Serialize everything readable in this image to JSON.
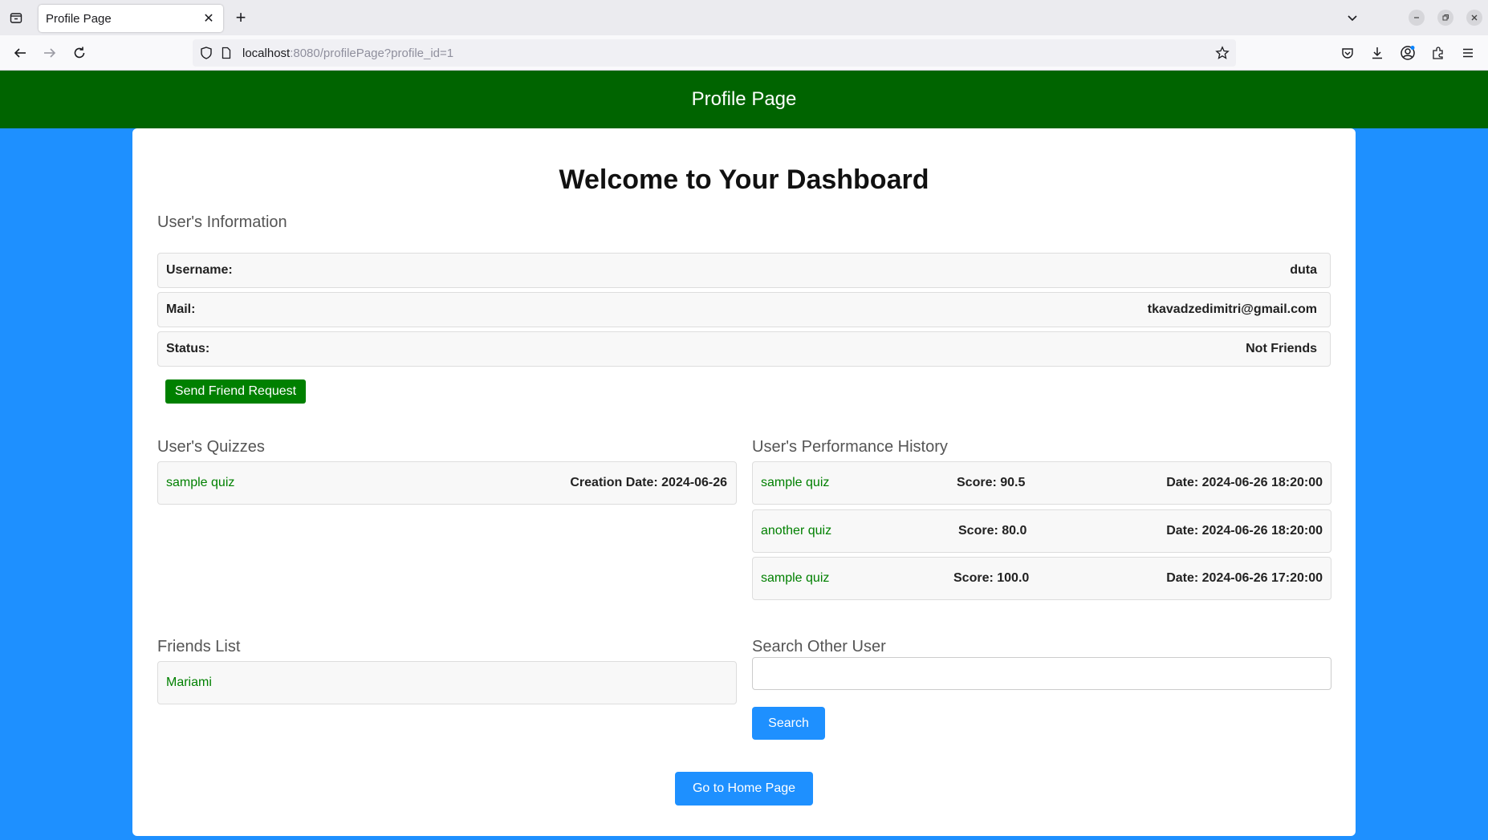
{
  "browser": {
    "tab_title": "Profile Page",
    "url_host": "localhost",
    "url_rest": ":8080/profilePage?profile_id=1"
  },
  "header": {
    "title": "Profile Page"
  },
  "main": {
    "title": "Welcome to Your Dashboard",
    "user_info": {
      "heading": "User's Information",
      "rows": [
        {
          "label": "Username:",
          "value": "duta"
        },
        {
          "label": "Mail:",
          "value": "tkavadzedimitri@gmail.com"
        },
        {
          "label": "Status:",
          "value": "Not Friends"
        }
      ],
      "friend_request_button": "Send Friend Request"
    },
    "quizzes": {
      "heading": "User's Quizzes",
      "items": [
        {
          "name": "sample quiz",
          "creation": "Creation Date: 2024-06-26"
        }
      ]
    },
    "performance": {
      "heading": "User's Performance History",
      "items": [
        {
          "quiz": "sample quiz",
          "score": "Score: 90.5",
          "date": "Date: 2024-06-26 18:20:00"
        },
        {
          "quiz": "another quiz",
          "score": "Score: 80.0",
          "date": "Date: 2024-06-26 18:20:00"
        },
        {
          "quiz": "sample quiz",
          "score": "Score: 100.0",
          "date": "Date: 2024-06-26 17:20:00"
        }
      ]
    },
    "friends": {
      "heading": "Friends List",
      "items": [
        {
          "name": "Mariami"
        }
      ]
    },
    "search": {
      "heading": "Search Other User",
      "value": "",
      "placeholder": "",
      "button": "Search"
    },
    "home_button": "Go to Home Page"
  },
  "colors": {
    "header_bg": "#006400",
    "page_bg": "#1e90ff",
    "link": "#008000",
    "primary_button": "#1e90ff",
    "friend_button": "#008000"
  }
}
